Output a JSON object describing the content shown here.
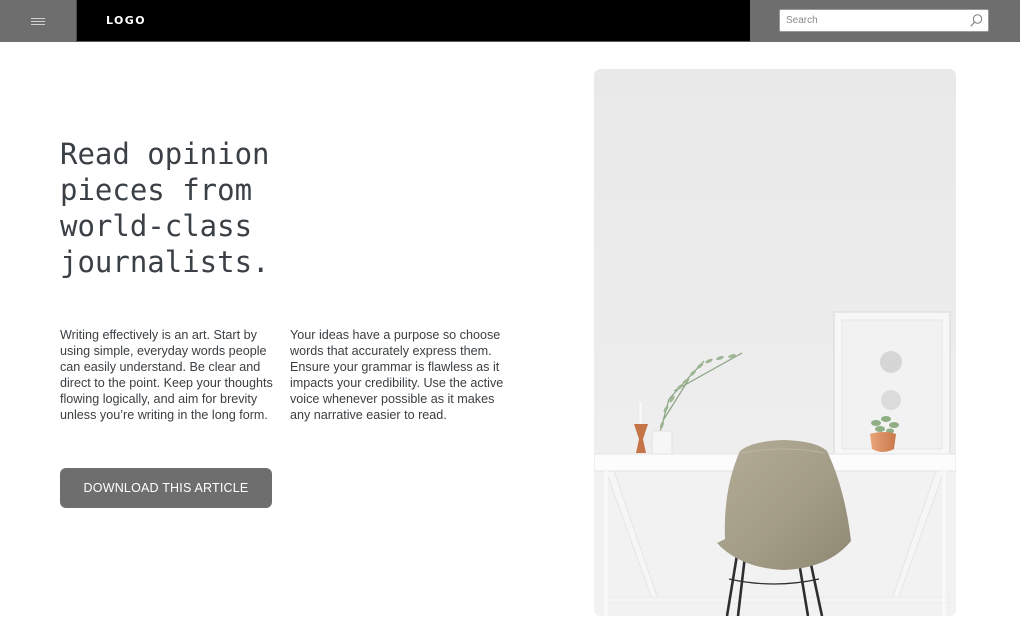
{
  "header": {
    "menu_icon": "hamburger-menu-icon",
    "logo_text": "LOGO",
    "search": {
      "placeholder": "Search",
      "value": "",
      "icon": "search-icon"
    }
  },
  "hero": {
    "headline": "Read opinion pieces from world-class journalists.",
    "paragraphs": [
      "Writing effectively is an art. Start by using simple, everyday words people can easily understand. Be clear and direct to the point. Keep your thoughts flowing logically, and aim for brevity unless you’re writing in the long form.",
      "Your ideas have a purpose so choose words that accurately express them. Ensure your grammar is flawless as it impacts your credibility. Use the active voice whenever possible as it makes any narrative easier to read."
    ],
    "cta_label": "DOWNLOAD THIS ARTICLE"
  },
  "colors": {
    "topbar": "#000000",
    "control_gray": "#6e6e6e",
    "heading_text": "#3a4045",
    "button_bg": "#6e6e6e",
    "button_text": "#ffffff"
  }
}
